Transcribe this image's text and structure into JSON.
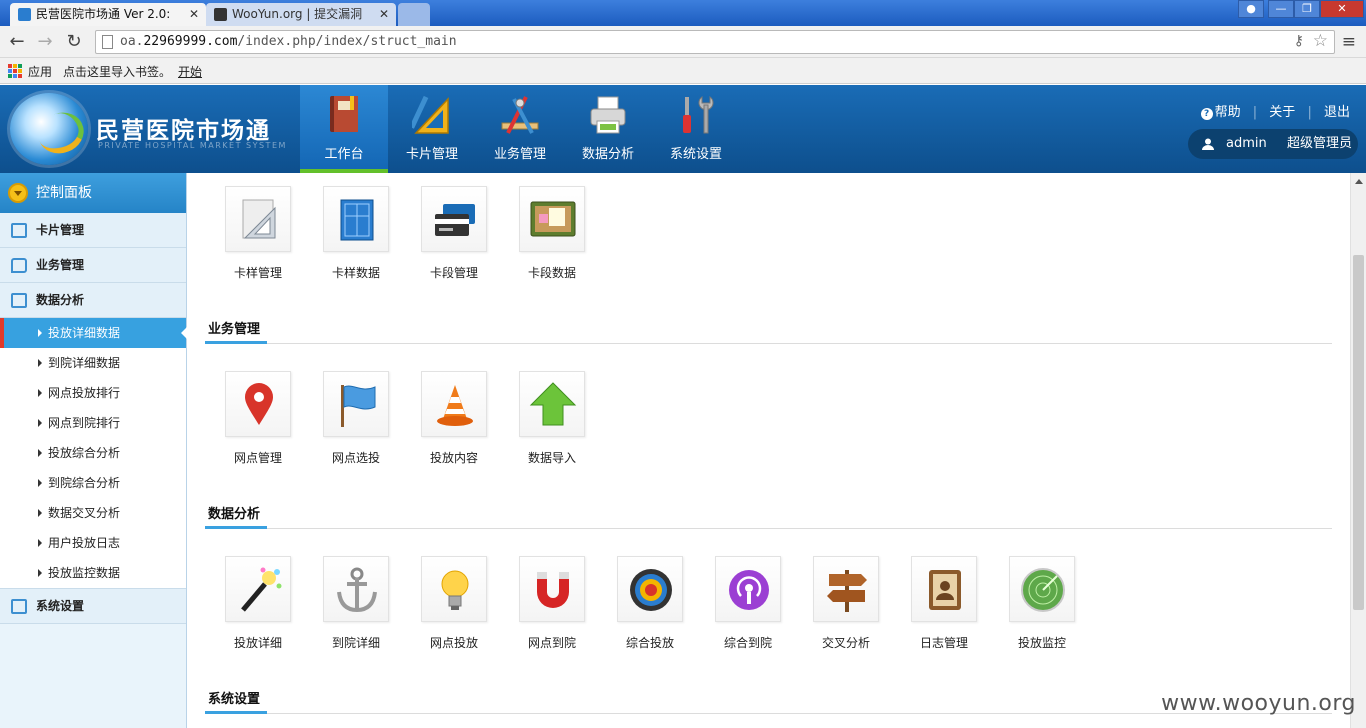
{
  "browser": {
    "tabs": [
      {
        "title": "民营医院市场通 Ver 2.0:",
        "active": true
      },
      {
        "title": "WooYun.org | 提交漏洞",
        "active": false
      }
    ],
    "close_glyph": "✕",
    "url_prefix": "oa.",
    "url_host": "22969999.com",
    "url_path": "/index.php/index/struct_main",
    "bookmarks": {
      "apps_label": "应用",
      "import_label": "点击这里导入书签。",
      "start_label": "开始"
    }
  },
  "header": {
    "logo_title": "民营医院市场通",
    "logo_subtitle": "PRIVATE HOSPITAL MARKET SYSTEM",
    "nav": [
      {
        "label": "工作台",
        "icon": "book-icon",
        "active": true
      },
      {
        "label": "卡片管理",
        "icon": "triangle-ruler-icon",
        "active": false
      },
      {
        "label": "业务管理",
        "icon": "drafting-tools-icon",
        "active": false
      },
      {
        "label": "数据分析",
        "icon": "printer-icon",
        "active": false
      },
      {
        "label": "系统设置",
        "icon": "tools-icon",
        "active": false
      }
    ],
    "help_label": "帮助",
    "about_label": "关于",
    "logout_label": "退出",
    "username": "admin",
    "role": "超级管理员"
  },
  "sidebar": {
    "title": "控制面板",
    "groups": [
      {
        "label": "卡片管理"
      },
      {
        "label": "业务管理"
      },
      {
        "label": "数据分析"
      },
      {
        "label": "系统设置"
      }
    ],
    "analysis_items": [
      {
        "label": "投放详细数据",
        "active": true
      },
      {
        "label": "到院详细数据",
        "active": false
      },
      {
        "label": "网点投放排行",
        "active": false
      },
      {
        "label": "网点到院排行",
        "active": false
      },
      {
        "label": "投放综合分析",
        "active": false
      },
      {
        "label": "到院综合分析",
        "active": false
      },
      {
        "label": "数据交叉分析",
        "active": false
      },
      {
        "label": "用户投放日志",
        "active": false
      },
      {
        "label": "投放监控数据",
        "active": false
      }
    ]
  },
  "main": {
    "card_tiles": [
      {
        "label": "卡样管理",
        "icon": "ruler-paper-icon"
      },
      {
        "label": "卡样数据",
        "icon": "blueprint-icon"
      },
      {
        "label": "卡段管理",
        "icon": "cards-icon"
      },
      {
        "label": "卡段数据",
        "icon": "corkboard-icon"
      }
    ],
    "business_title": "业务管理",
    "business_tiles": [
      {
        "label": "网点管理",
        "icon": "map-pin-icon"
      },
      {
        "label": "网点选投",
        "icon": "flag-icon"
      },
      {
        "label": "投放内容",
        "icon": "traffic-cone-icon"
      },
      {
        "label": "数据导入",
        "icon": "up-arrow-icon"
      }
    ],
    "analysis_title": "数据分析",
    "analysis_tiles": [
      {
        "label": "投放详细",
        "icon": "magic-wand-icon"
      },
      {
        "label": "到院详细",
        "icon": "anchor-icon"
      },
      {
        "label": "网点投放",
        "icon": "light-bulb-icon"
      },
      {
        "label": "网点到院",
        "icon": "magnet-icon"
      },
      {
        "label": "综合投放",
        "icon": "target-icon"
      },
      {
        "label": "综合到院",
        "icon": "podcast-icon"
      },
      {
        "label": "交叉分析",
        "icon": "signpost-icon"
      },
      {
        "label": "日志管理",
        "icon": "address-book-icon"
      },
      {
        "label": "投放监控",
        "icon": "radar-icon"
      }
    ],
    "system_title": "系统设置"
  },
  "watermark": "www.wooyun.org"
}
